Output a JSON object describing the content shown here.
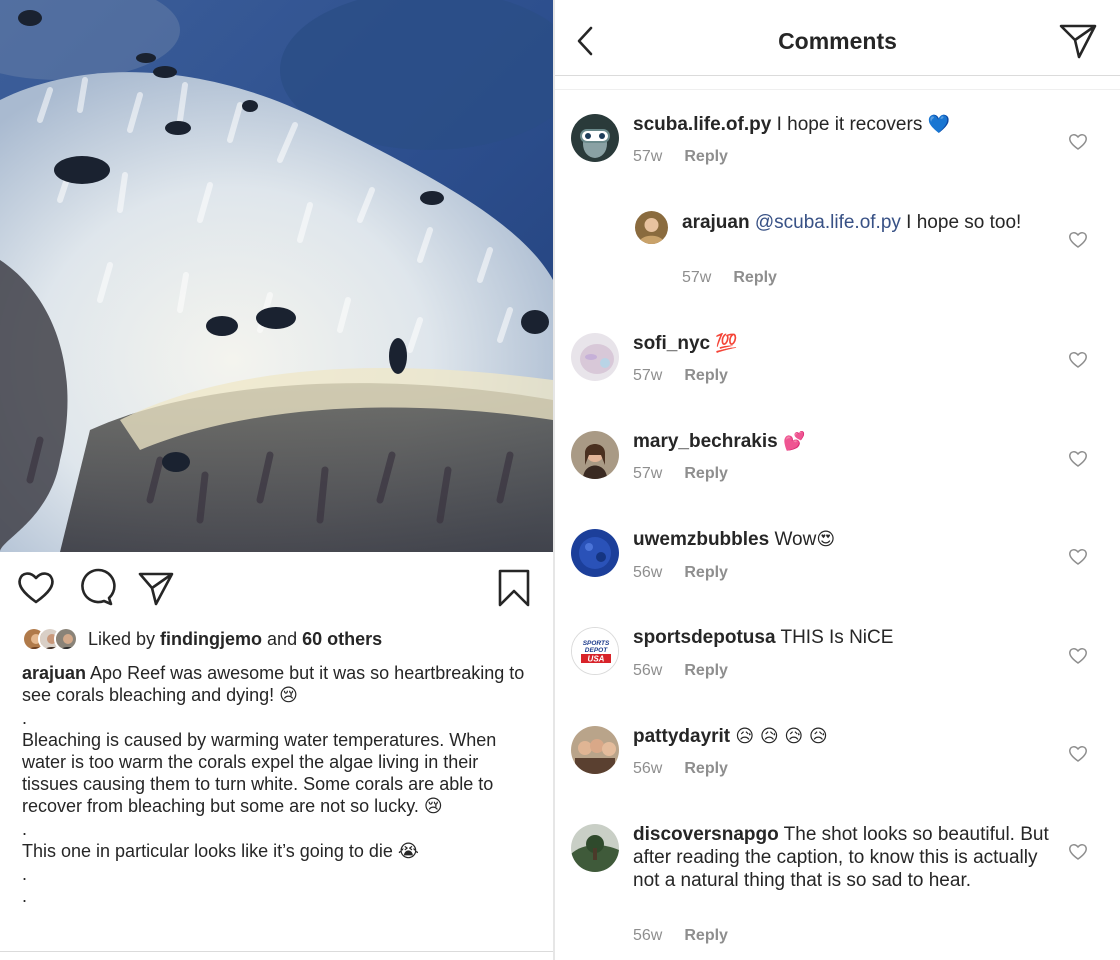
{
  "post": {
    "likes": {
      "prefix": "Liked by ",
      "user": "findingjemo",
      "middle": " and ",
      "others": "60 others"
    },
    "caption": {
      "user": "arajuan",
      "line1": " Apo Reef was awesome but it was so heartbreaking to see corals bleaching and dying! ",
      "emoji1": "😢",
      "dot1": ".",
      "para2": "Bleaching is caused by warming water temperatures. When water is too warm the corals expel the algae living in their tissues causing them to turn white. Some corals are able to recover from bleaching but some are not so lucky. ",
      "emoji2": "😢",
      "dot2": ".",
      "para3": "This one in particular looks like it’s going to die ",
      "emoji3": "😭",
      "dot3": ".",
      "dot4": "."
    }
  },
  "header": {
    "title": "Comments"
  },
  "comments": [
    {
      "user": "scuba.life.of.py",
      "text": " I hope it recovers ",
      "emoji": "💙",
      "time": "57w",
      "reply": "Reply"
    },
    {
      "user": "arajuan",
      "mention": "@scuba.life.of.py",
      "text": " I hope so too!",
      "time": "57w",
      "reply": "Reply"
    },
    {
      "user": "sofi_nyc",
      "emoji": "💯",
      "time": "57w",
      "reply": "Reply"
    },
    {
      "user": "mary_bechrakis",
      "emoji": "💕",
      "time": "57w",
      "reply": "Reply"
    },
    {
      "user": "uwemzbubbles",
      "text": " Wow",
      "emoji": "😍",
      "time": "56w",
      "reply": "Reply"
    },
    {
      "user": "sportsdepotusa",
      "text": " THIS Is NiCE",
      "time": "56w",
      "reply": "Reply"
    },
    {
      "user": "pattydayrit",
      "emoji": "😥 😥 😥 😥",
      "time": "56w",
      "reply": "Reply"
    },
    {
      "user": "discoversnapgo",
      "text": " The shot looks so beautiful. But after reading the caption, to know this is actually not a natural thing that is so sad to hear.",
      "time": "56w",
      "reply": "Reply"
    }
  ],
  "sportsdepot_logo": {
    "line1": "SPORTS",
    "line2": "DEPOT",
    "line3": "USA"
  },
  "icons": [
    "heart-icon",
    "comment-icon",
    "send-icon",
    "bookmark-icon",
    "back-chevron-icon",
    "direct-icon"
  ]
}
